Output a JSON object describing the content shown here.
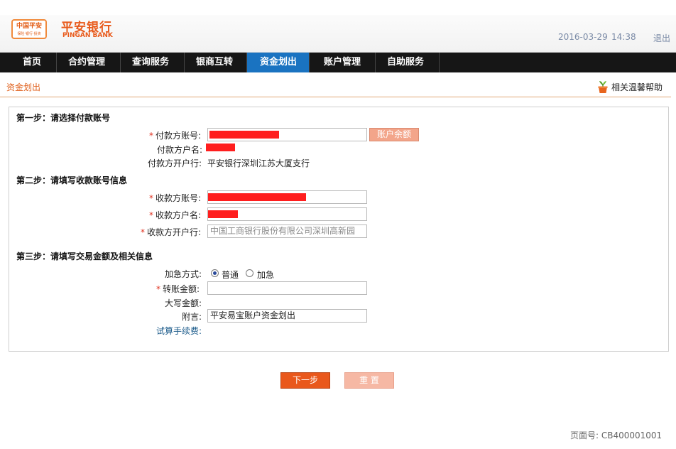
{
  "header": {
    "logo_badge_text": "中国平安",
    "logo_badge_sub": "保险·银行·投资",
    "brand_cn": "平安银行",
    "brand_en": "PINGAN BANK",
    "date": "2016-03-29",
    "time": "14:38",
    "logout": "退出"
  },
  "nav": {
    "items": [
      {
        "label": "首页"
      },
      {
        "label": "合约管理"
      },
      {
        "label": "查询服务"
      },
      {
        "label": "银商互转"
      },
      {
        "label": "资金划出"
      },
      {
        "label": "账户管理"
      },
      {
        "label": "自助服务"
      }
    ],
    "active": "资金划出"
  },
  "breadcrumb": "资金划出",
  "help_label": "相关温馨帮助",
  "step1": {
    "title": "第一步：请选择付款账号",
    "payer_account_label": "付款方账号:",
    "balance_button": "账户余额",
    "payer_name_label": "付款方户名:",
    "payer_bank_label": "付款方开户行:",
    "payer_bank_value": "平安银行深圳江苏大厦支行"
  },
  "step2": {
    "title": "第二步：请填写收款账号信息",
    "payee_account_label": "收款方账号:",
    "payee_name_label": "收款方户名:",
    "payee_bank_label": "收款方开户行:",
    "payee_bank_value": "中国工商银行股份有限公司深圳高新园"
  },
  "step3": {
    "title": "第三步：请填写交易金额及相关信息",
    "urgency_label": "加急方式:",
    "urgency_options": [
      "普通",
      "加急"
    ],
    "urgency_selected": "普通",
    "amount_label": "转账金额:",
    "amount_value": "",
    "amount_upper_label": "大写金额:",
    "note_label": "附言:",
    "note_value": "平安易宝账户资金划出",
    "fee_link": "试算手续费:"
  },
  "required_mark": "*",
  "buttons": {
    "next": "下一步",
    "reset": "重 置"
  },
  "page_number": "页面号: CB400001001",
  "colors": {
    "brand": "#e8591a",
    "nav_bg": "#161616",
    "nav_active": "#1a73c1",
    "redaction": "#ff1e1e"
  }
}
